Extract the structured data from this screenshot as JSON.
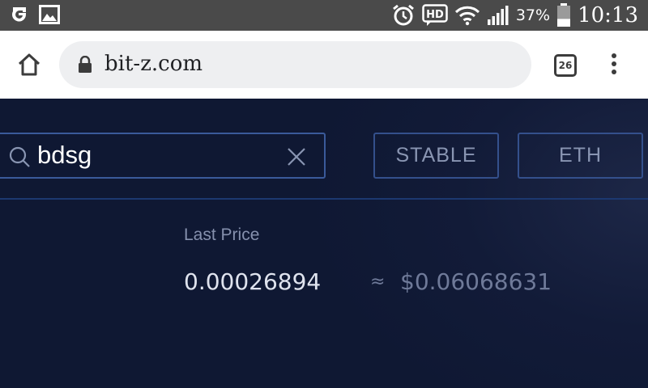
{
  "status_bar": {
    "left_icons": [
      "g-notification-icon",
      "image-notification-icon"
    ],
    "right_icons": [
      "alarm-icon",
      "hd-voice-icon",
      "wifi-icon",
      "signal-icon",
      "battery-icon"
    ],
    "battery_percent": "37%",
    "battery_level": 0.37,
    "time": "10:13"
  },
  "browser": {
    "url": "bit-z.com",
    "tab_count": "26"
  },
  "search": {
    "value": "bdsg"
  },
  "filters": {
    "stable_label": "STABLE",
    "eth_label": "ETH"
  },
  "price": {
    "label": "Last Price",
    "value": "0.00026894",
    "approx_symbol": "≈",
    "usd_value": "$0.06068631"
  },
  "colors": {
    "page_bg": "#0f1833",
    "border_accent": "#3a5a9a",
    "muted_text": "#8590ad"
  }
}
